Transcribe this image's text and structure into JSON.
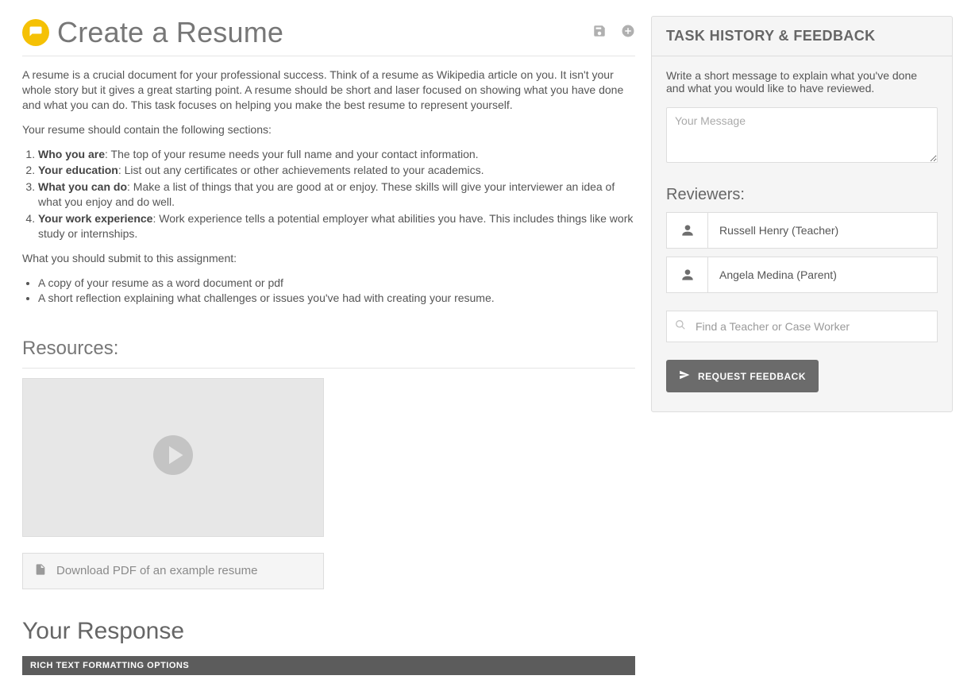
{
  "header": {
    "title": "Create a Resume"
  },
  "intro": {
    "p1": "A resume is a crucial document for your professional success. Think of a resume as Wikipedia article on you. It isn't your whole story but it gives a great starting point. A resume should be short and laser focused on showing what you have done and what you can do. This task focuses on helping you make the best resume to represent yourself.",
    "p2": "Your resume should contain the following sections:",
    "list": [
      {
        "b": "Who you are",
        "t": ":  The top of your resume needs your full name and your contact information."
      },
      {
        "b": "Your education",
        "t": ": List out any certificates or other achievements related to your academics."
      },
      {
        "b": "What you can do",
        "t": ": Make a list of things that you are good at or enjoy. These skills will give your interviewer an idea of what you enjoy and do well."
      },
      {
        "b": "Your work experience",
        "t": ": Work experience tells a potential employer what abilities you have. This includes things like work study or internships."
      }
    ],
    "p3": "What you should submit to this assignment:",
    "bullets": [
      "A copy of your resume as a word document or pdf",
      "A short reflection explaining what challenges or issues you've had with creating your resume."
    ]
  },
  "resources": {
    "heading": "Resources:",
    "download_label": "Download PDF of an example resume"
  },
  "response": {
    "heading": "Your Response",
    "rtf_bar": "RICH TEXT FORMATTING OPTIONS"
  },
  "side": {
    "panel_title": "TASK HISTORY & FEEDBACK",
    "hint": "Write a short message to explain what you've done and what you would like to have reviewed.",
    "message_placeholder": "Your Message",
    "reviewers_heading": "Reviewers:",
    "reviewers": [
      "Russell Henry (Teacher)",
      "Angela Medina (Parent)"
    ],
    "find_placeholder": "Find a Teacher or Case Worker",
    "request_label": "REQUEST FEEDBACK"
  }
}
